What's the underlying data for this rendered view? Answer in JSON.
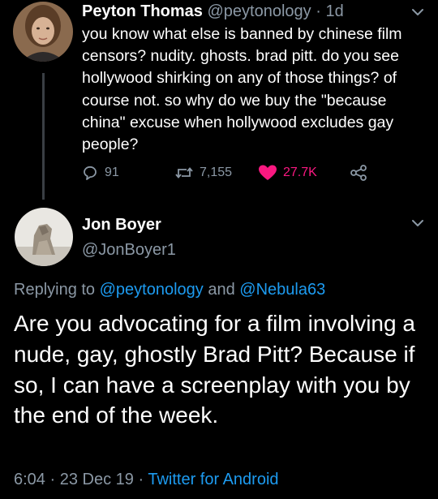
{
  "colors": {
    "background": "#000000",
    "text": "#ffffff",
    "muted": "#8b98a5",
    "link": "#1d9bf0",
    "like": "#f91880"
  },
  "tweet1": {
    "name": "Peyton Thomas",
    "handle": "@peytonology",
    "separator": "·",
    "time": "1d",
    "text": "you know what else is banned by chinese film censors? nudity. ghosts. brad pitt. do you see hollywood shirking on any of those things? of course not. so why do we buy the \"because china\" excuse when hollywood excludes gay people?",
    "reply_icon": "speech-bubble-icon",
    "replies": "91",
    "retweet_icon": "retweet-arrows-icon",
    "retweets": "7,155",
    "like_icon": "heart-filled-icon",
    "likes": "27.7K",
    "share_icon": "share-nodes-icon",
    "menu_icon": "chevron-down-icon"
  },
  "tweet2": {
    "name": "Jon Boyer",
    "handle": "@JonBoyer1",
    "replying_prefix": "Replying to",
    "mention1": "@peytonology",
    "conjunction": "and",
    "mention2": "@Nebula63",
    "text": "Are you advocating for a film involving a nude, gay, ghostly Brad Pitt? Because if so, I can have a screenplay with you by the end of the week.",
    "time": "6:04",
    "dot1": "·",
    "date": "23 Dec 19",
    "dot2": "·",
    "source": "Twitter for Android",
    "menu_icon": "chevron-down-icon"
  }
}
